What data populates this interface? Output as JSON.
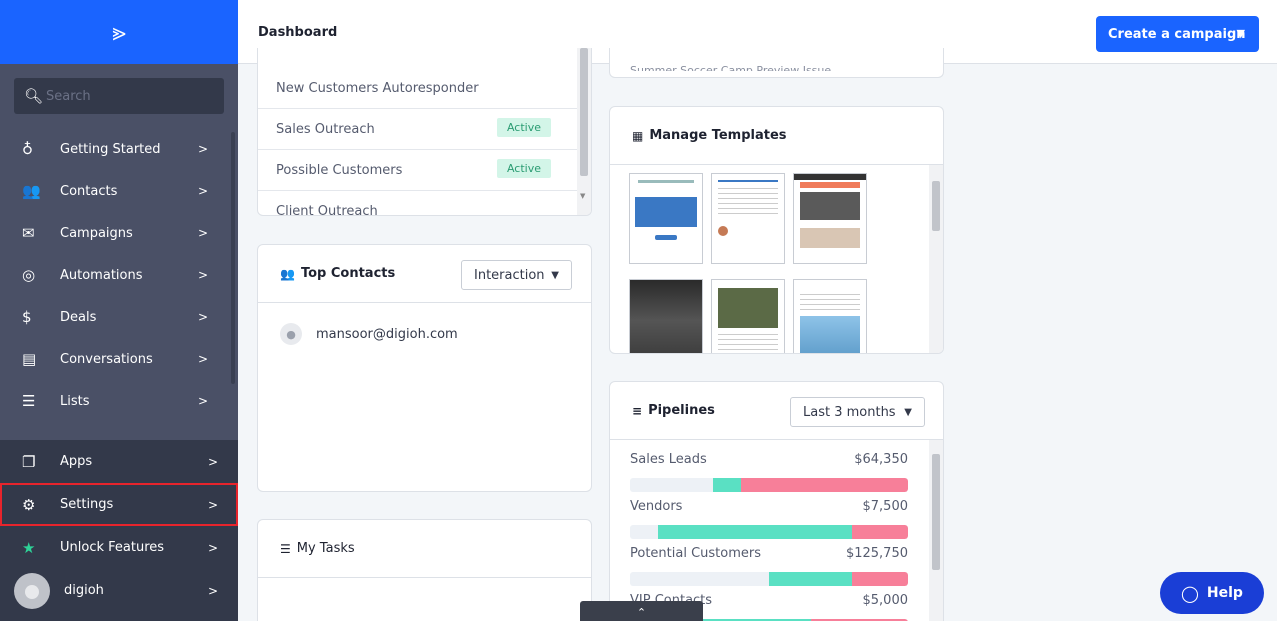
{
  "brand": {
    "logo_glyph": "⪢"
  },
  "search": {
    "placeholder": "Search"
  },
  "nav": [
    {
      "id": "getting-started",
      "label": "Getting Started",
      "icon": "lightbulb-icon",
      "glyph": "♁"
    },
    {
      "id": "contacts",
      "label": "Contacts",
      "icon": "contacts-icon",
      "glyph": "👥"
    },
    {
      "id": "campaigns",
      "label": "Campaigns",
      "icon": "envelope-icon",
      "glyph": "✉"
    },
    {
      "id": "automations",
      "label": "Automations",
      "icon": "automation-icon",
      "glyph": "◎"
    },
    {
      "id": "deals",
      "label": "Deals",
      "icon": "dollar-icon",
      "glyph": "$"
    },
    {
      "id": "conversations",
      "label": "Conversations",
      "icon": "chat-icon",
      "glyph": "▤"
    },
    {
      "id": "lists",
      "label": "Lists",
      "icon": "list-icon",
      "glyph": "☰"
    }
  ],
  "bottom_nav": [
    {
      "id": "apps",
      "label": "Apps",
      "icon": "apps-icon",
      "glyph": "❐"
    },
    {
      "id": "settings",
      "label": "Settings",
      "icon": "gear-icon",
      "glyph": "⚙"
    },
    {
      "id": "unlock-features",
      "label": "Unlock Features",
      "icon": "star-icon",
      "glyph": "★"
    },
    {
      "id": "account",
      "label": "digioh",
      "icon": "avatar-icon"
    }
  ],
  "topbar": {
    "title": "Dashboard",
    "cta_label": "Create a campaign"
  },
  "automations": [
    {
      "name": "New Customers Autoresponder",
      "status": ""
    },
    {
      "name": "Sales Outreach",
      "status": "Active"
    },
    {
      "name": "Possible Customers",
      "status": "Active"
    },
    {
      "name": "Client Outreach",
      "status": ""
    }
  ],
  "campaign_peek": "Summer Soccer Camp Preview Issue",
  "top_contacts": {
    "title": "Top Contacts",
    "filter": "Interaction",
    "contacts": [
      "mansoor@digioh.com"
    ]
  },
  "tasks": {
    "title": "My Tasks"
  },
  "templates": {
    "title": "Manage Templates"
  },
  "pipelines": {
    "title": "Pipelines",
    "filter": "Last 3 months",
    "items": [
      {
        "name": "Sales Leads",
        "amount": "$64,350",
        "split": [
          0.3,
          0.1,
          0.6
        ]
      },
      {
        "name": "Vendors",
        "amount": "$7,500",
        "split": [
          0.1,
          0.7,
          0.2
        ]
      },
      {
        "name": "Potential Customers",
        "amount": "$125,750",
        "split": [
          0.5,
          0.3,
          0.2
        ]
      },
      {
        "name": "VIP Contacts",
        "amount": "$5,000",
        "split": [
          0.1,
          0.55,
          0.35
        ]
      }
    ]
  },
  "colors": {
    "accent": "#1a64ff",
    "sidebar": "#4a5066",
    "won": "#5ae0c3",
    "lost": "#f77f99",
    "open": "#edf1f6"
  },
  "help": {
    "label": "Help"
  },
  "collapse_glyph": "⌃"
}
